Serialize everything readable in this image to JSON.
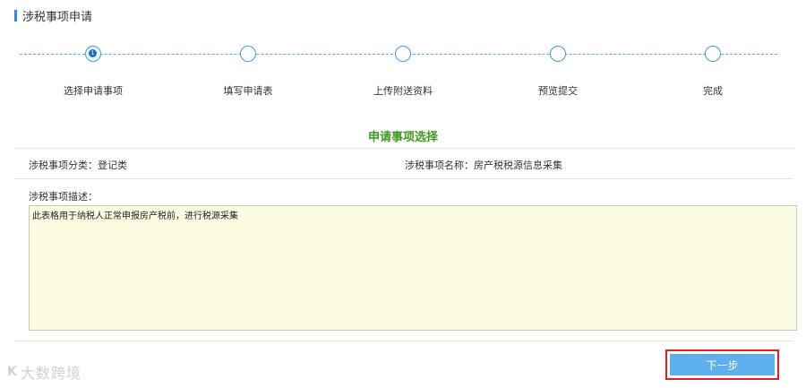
{
  "header": {
    "title": "涉税事项申请"
  },
  "steps": [
    {
      "label": "选择申请事项",
      "active": true,
      "number": "1"
    },
    {
      "label": "填写申请表",
      "active": false
    },
    {
      "label": "上传附送资料",
      "active": false
    },
    {
      "label": "预览提交",
      "active": false
    },
    {
      "label": "完成",
      "active": false
    }
  ],
  "section": {
    "title": "申请事项选择"
  },
  "fields": {
    "category": "涉税事项分类：登记类",
    "name": "涉税事项名称：房产税税源信息采集",
    "description_label": "涉税事项描述：",
    "description_value": "此表格用于纳税人正常申报房产税前，进行税源采集"
  },
  "actions": {
    "next_label": "下一步"
  },
  "watermark": {
    "logo": "K",
    "text": "大数跨境"
  },
  "colors": {
    "accent": "#5fb0ee",
    "section_title": "#3d9a1e",
    "highlight_border": "#e02020",
    "description_bg": "#fcfce3"
  }
}
